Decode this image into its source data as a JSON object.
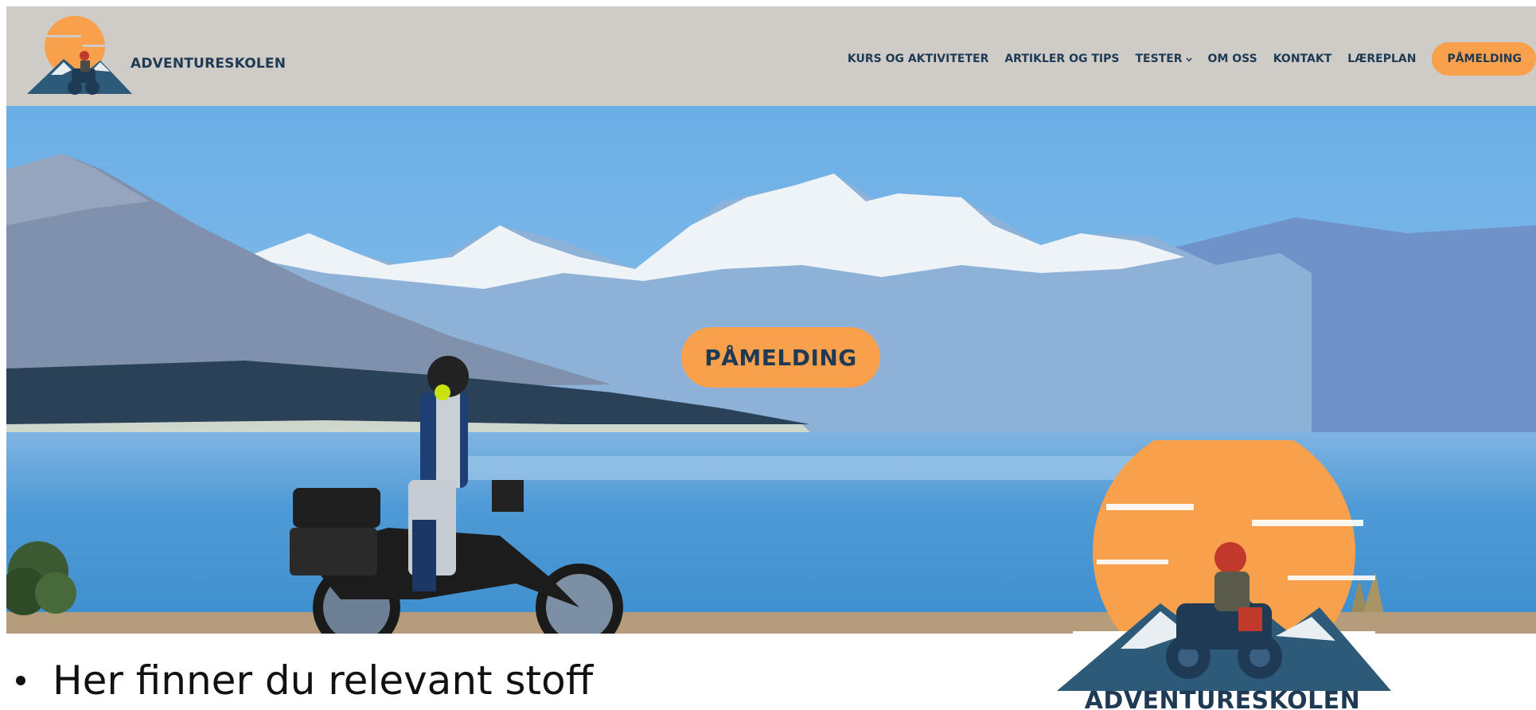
{
  "header": {
    "logo_text": "ADVENTURESKOLEN",
    "nav": [
      {
        "label": "KURS OG AKTIVITETER"
      },
      {
        "label": "ARTIKLER OG TIPS"
      },
      {
        "label": "TESTER"
      },
      {
        "label": "OM OSS"
      },
      {
        "label": "KONTAKT"
      },
      {
        "label": "LÆREPLAN"
      }
    ],
    "cta_label": "PÅMELDING"
  },
  "hero": {
    "cta_label": "PÅMELDING"
  },
  "content": {
    "bullet_text": "Her finner du relevant stoff"
  },
  "big_logo": {
    "text": "ADVENTURESKOLEN"
  },
  "colors": {
    "header_bg": "#cfccc7",
    "accent_orange": "#f8a04b",
    "navy": "#1f3a55"
  },
  "icons": {
    "dropdown": "chevron-down-icon"
  }
}
